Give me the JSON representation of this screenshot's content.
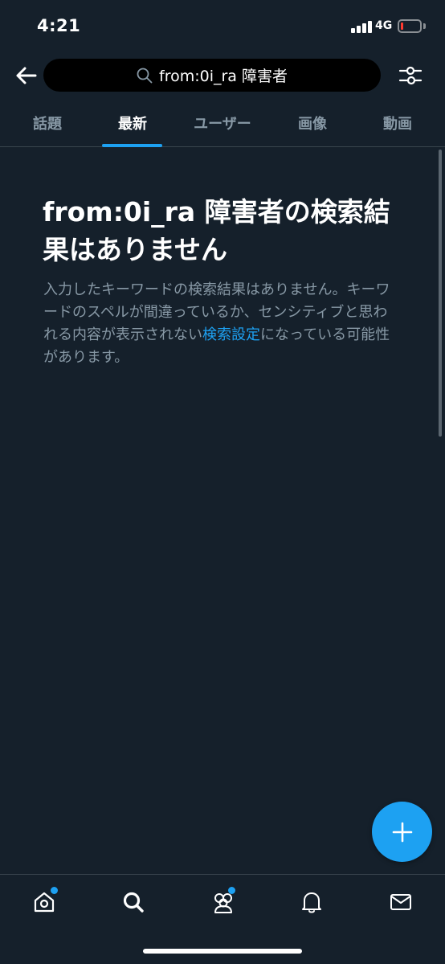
{
  "status_bar": {
    "time": "4:21",
    "network": "4G",
    "battery_level": 0.12,
    "battery_color": "#ff3b30"
  },
  "header": {
    "back_icon": "arrow-left-icon",
    "search_icon": "magnifier-icon",
    "search_query": "from:0i_ra 障害者",
    "filter_icon": "sliders-icon"
  },
  "tabs": [
    {
      "label": "話題",
      "active": false
    },
    {
      "label": "最新",
      "active": true
    },
    {
      "label": "ユーザー",
      "active": false
    },
    {
      "label": "画像",
      "active": false
    },
    {
      "label": "動画",
      "active": false
    }
  ],
  "result": {
    "title": "from:0i_ra 障害者の検索結果はありません",
    "body_before": "入力したキーワードの検索結果はありません。キーワードのスペルが間違っているか、センシティブと思われる内容が表示されない",
    "link_text": "検索設定",
    "body_after": "になっている可能性があります。"
  },
  "fab": {
    "icon": "plus-icon"
  },
  "bottom_nav": [
    {
      "name": "home",
      "icon": "home-icon",
      "has_dot": true
    },
    {
      "name": "search",
      "icon": "search-icon",
      "has_dot": false
    },
    {
      "name": "communities",
      "icon": "communities-icon",
      "has_dot": true
    },
    {
      "name": "notifications",
      "icon": "bell-icon",
      "has_dot": false
    },
    {
      "name": "messages",
      "icon": "mail-icon",
      "has_dot": false
    }
  ],
  "colors": {
    "background": "#15202b",
    "accent": "#1da1f2",
    "secondary_text": "#8899a6",
    "divider": "#38444d"
  }
}
